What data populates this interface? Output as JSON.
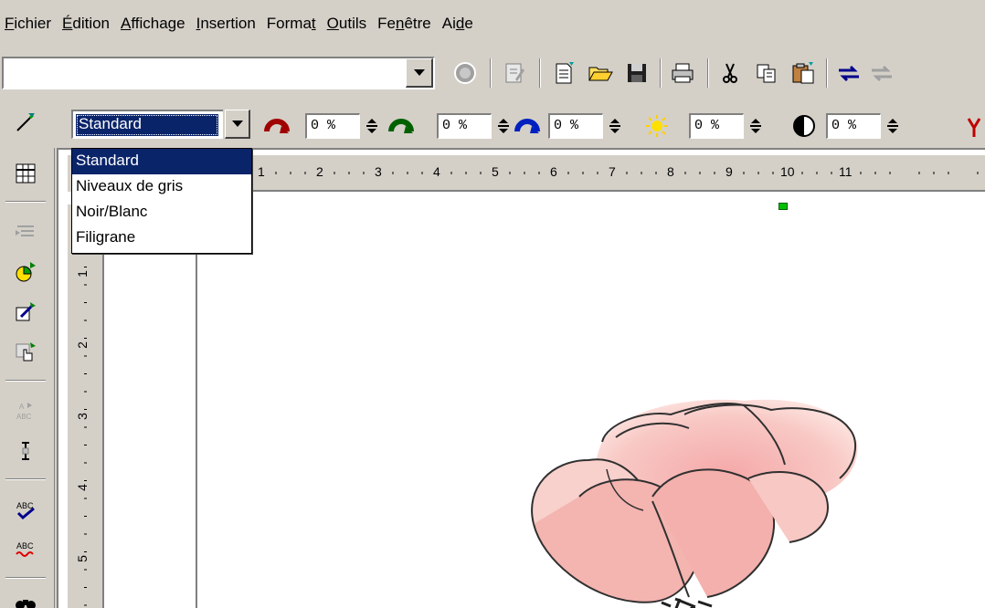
{
  "menubar": [
    {
      "pre": "",
      "acc": "F",
      "post": "ichier"
    },
    {
      "pre": "",
      "acc": "É",
      "post": "dition"
    },
    {
      "pre": "",
      "acc": "A",
      "post": "ffichage"
    },
    {
      "pre": "",
      "acc": "I",
      "post": "nsertion"
    },
    {
      "pre": "Forma",
      "acc": "t",
      "post": ""
    },
    {
      "pre": "",
      "acc": "O",
      "post": "utils"
    },
    {
      "pre": "Fe",
      "acc": "n",
      "post": "être"
    },
    {
      "pre": "Ai",
      "acc": "d",
      "post": "e"
    }
  ],
  "function_toolbar": {
    "url_value": ""
  },
  "filter_toolbar": {
    "mode_value": "Standard",
    "red": "0 %",
    "green": "0 %",
    "blue": "0 %",
    "brightness": "0 %",
    "contrast": "0 %"
  },
  "mode_list": {
    "options": [
      "Standard",
      "Niveaux de gris",
      "Noir/Blanc",
      "Filigrane"
    ],
    "selected": 0
  },
  "ruler": {
    "h_labels": [
      "1",
      "2",
      "3",
      "4",
      "5",
      "6",
      "7",
      "8",
      "9",
      "10",
      "11"
    ],
    "v_labels": [
      "1",
      "2",
      "3",
      "4",
      "5"
    ]
  },
  "colors": {
    "face": "#d4d0c8",
    "highlight": "#0a246a",
    "handle": "#00c000"
  }
}
